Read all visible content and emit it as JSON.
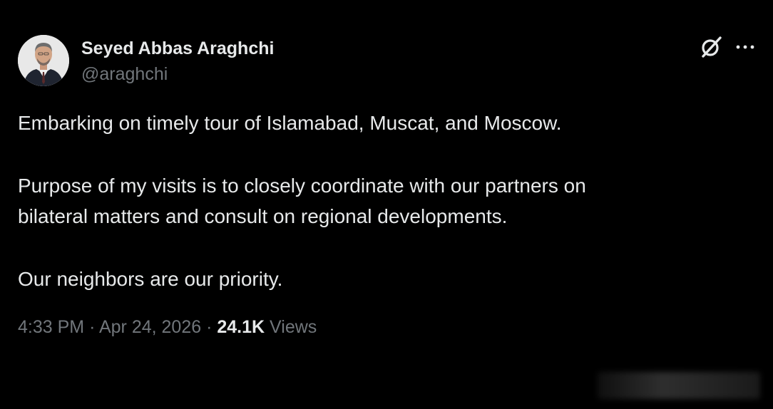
{
  "author": {
    "display_name": "Seyed Abbas Araghchi",
    "handle": "@araghchi",
    "avatar_icon": "profile-photo"
  },
  "actions": {
    "grok_icon": "grok-icon",
    "more_icon": "more-options-icon",
    "more_label": "···"
  },
  "tweet": {
    "paragraphs": [
      {
        "lines": [
          "Embarking on timely tour of Islamabad, Muscat, and Moscow."
        ]
      },
      {
        "lines": [
          "Purpose of my visits is to closely coordinate with our partners on",
          "bilateral matters and consult on regional developments."
        ]
      },
      {
        "lines": [
          "Our neighbors are our priority."
        ]
      }
    ]
  },
  "meta": {
    "time": "4:33 PM",
    "separator": "·",
    "date": "Apr 24, 2026",
    "views_count": "24.1K",
    "views_label": "Views"
  },
  "colors": {
    "background": "#000000",
    "primary_text": "#e7e9ea",
    "secondary_text": "#71767b"
  }
}
